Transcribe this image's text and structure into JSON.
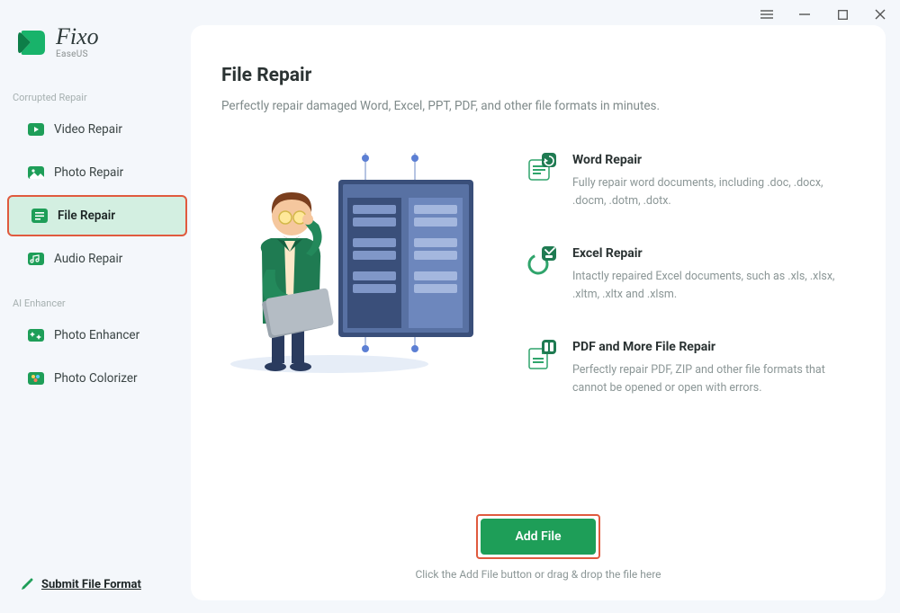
{
  "brand": {
    "name": "Fixo",
    "sub": "EaseUS"
  },
  "sidebar": {
    "sections": [
      {
        "label": "Corrupted Repair",
        "items": [
          {
            "label": "Video Repair",
            "icon": "video-icon",
            "active": false
          },
          {
            "label": "Photo Repair",
            "icon": "photo-icon",
            "active": false
          },
          {
            "label": "File Repair",
            "icon": "file-icon",
            "active": true
          },
          {
            "label": "Audio Repair",
            "icon": "audio-icon",
            "active": false
          }
        ]
      },
      {
        "label": "AI Enhancer",
        "items": [
          {
            "label": "Photo Enhancer",
            "icon": "enhancer-icon",
            "active": false
          },
          {
            "label": "Photo Colorizer",
            "icon": "colorizer-icon",
            "active": false
          }
        ]
      }
    ],
    "submit_label": "Submit File Format"
  },
  "main": {
    "title": "File Repair",
    "subtitle": "Perfectly repair damaged Word, Excel, PPT, PDF, and other file formats in minutes.",
    "features": [
      {
        "title": "Word Repair",
        "desc": "Fully repair word documents, including .doc, .docx, .docm, .dotm, .dotx."
      },
      {
        "title": "Excel Repair",
        "desc": "Intactly repaired Excel documents, such as .xls, .xlsx, .xltm, .xltx and .xlsm."
      },
      {
        "title": "PDF and More File Repair",
        "desc": "Perfectly repair PDF, ZIP and other file formats that cannot be opened or open with errors."
      }
    ],
    "cta": {
      "button": "Add File",
      "hint": "Click the Add File button or drag & drop the file here"
    }
  }
}
